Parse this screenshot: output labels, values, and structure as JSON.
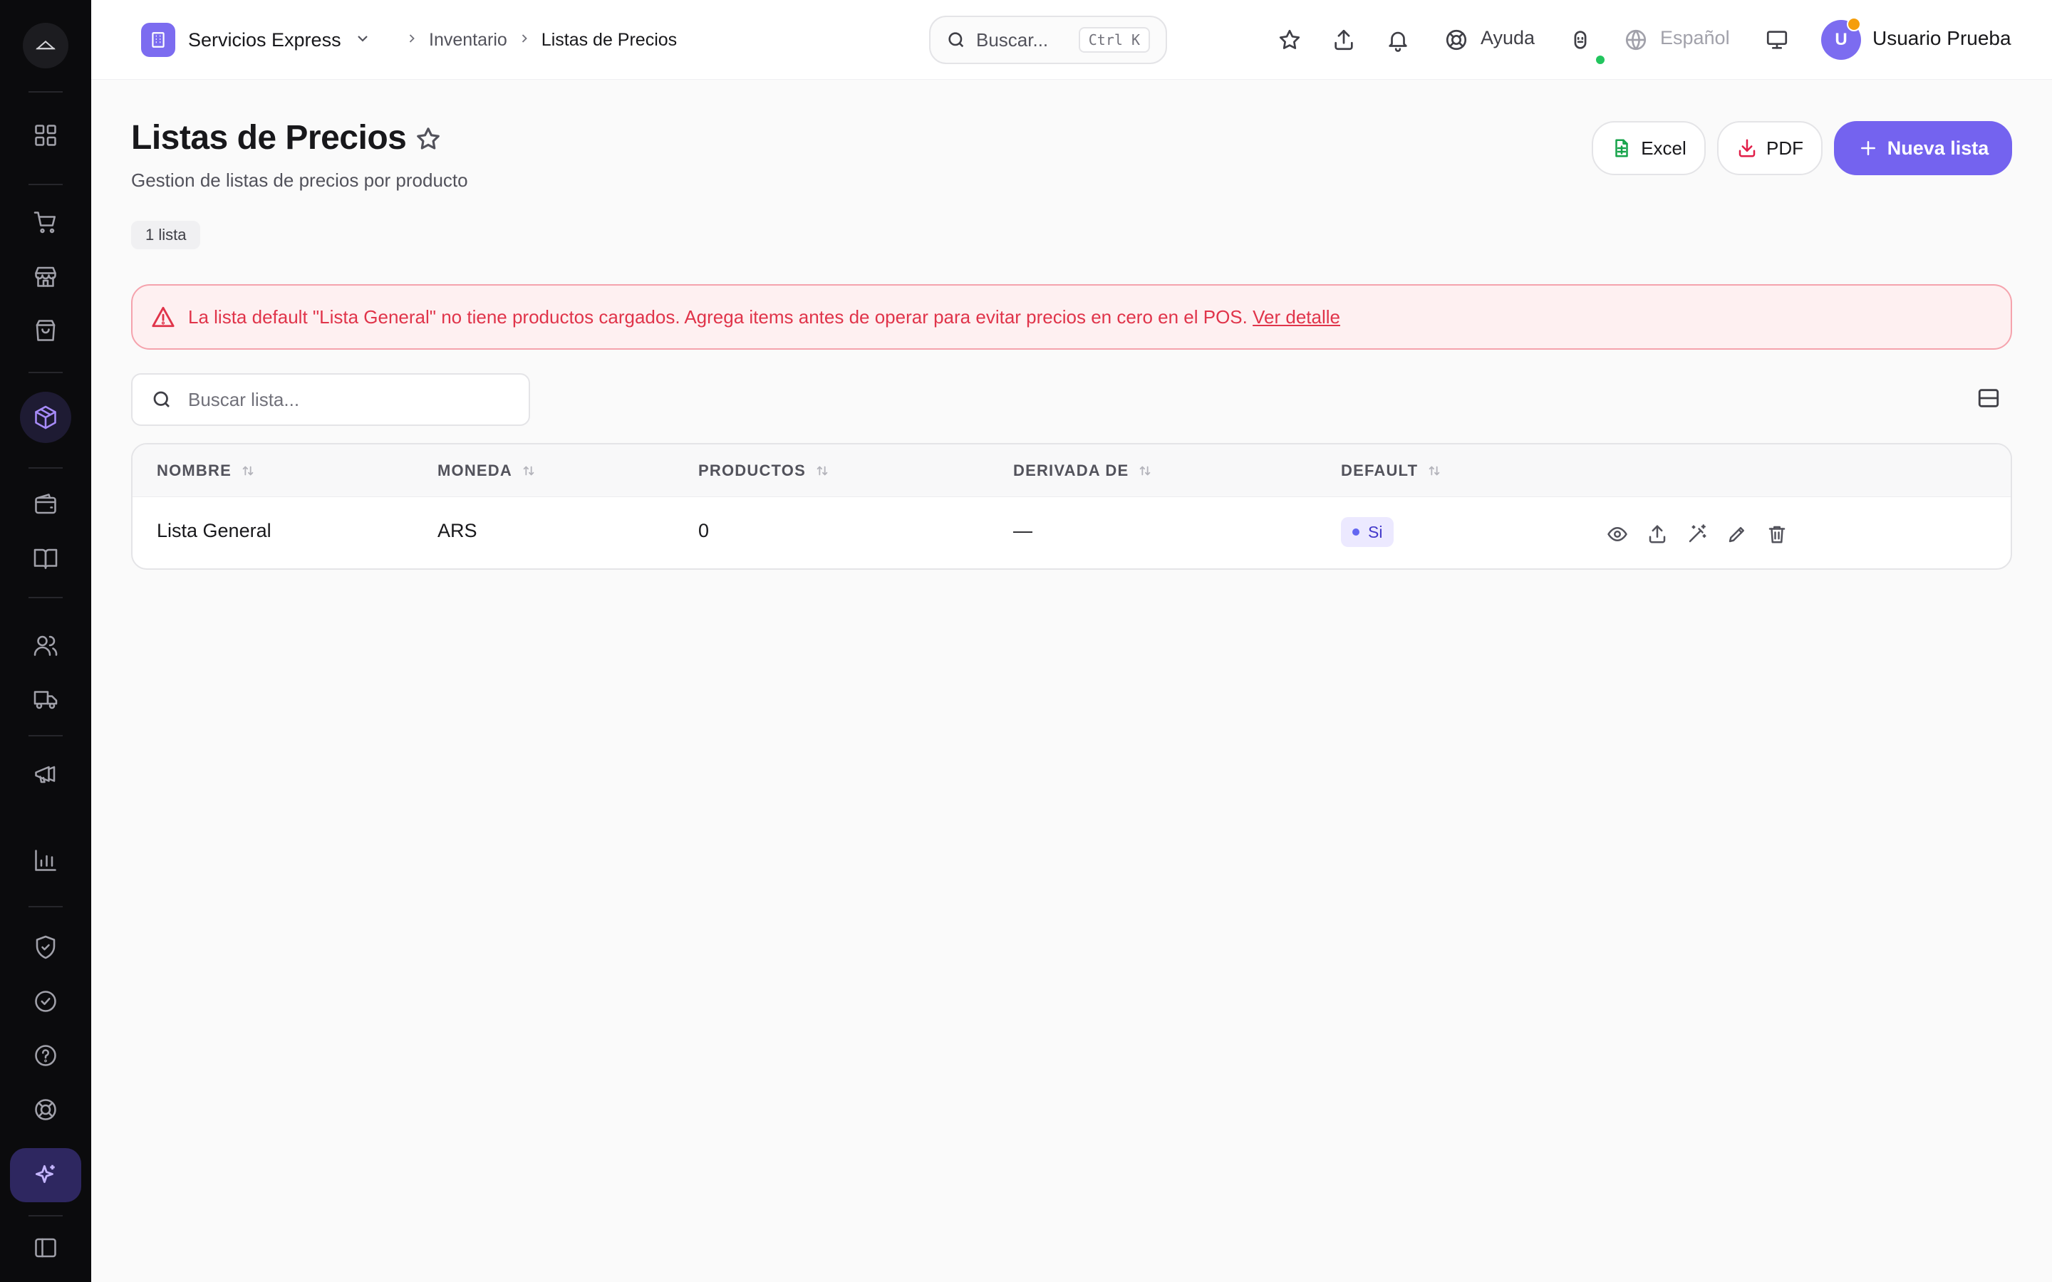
{
  "sidebar": {
    "items": [
      {
        "name": "dashboard",
        "icon": "grid-icon"
      },
      {
        "name": "sales",
        "icon": "cart-icon"
      },
      {
        "name": "store",
        "icon": "store-icon"
      },
      {
        "name": "purchases",
        "icon": "bag-icon"
      },
      {
        "name": "inventory",
        "icon": "box-icon",
        "active": true
      },
      {
        "name": "wallet",
        "icon": "wallet-icon"
      },
      {
        "name": "books",
        "icon": "book-icon"
      },
      {
        "name": "users",
        "icon": "users-icon"
      },
      {
        "name": "delivery",
        "icon": "truck-icon"
      },
      {
        "name": "marketing",
        "icon": "megaphone-icon"
      },
      {
        "name": "reports",
        "icon": "chart-icon"
      },
      {
        "name": "security",
        "icon": "shield-icon"
      },
      {
        "name": "tasks",
        "icon": "check-circle-icon"
      },
      {
        "name": "help",
        "icon": "question-icon"
      },
      {
        "name": "support",
        "icon": "lifebuoy-icon"
      },
      {
        "name": "ai-assistant",
        "icon": "sparkles-icon"
      },
      {
        "name": "collapse",
        "icon": "sidebar-toggle-icon"
      }
    ]
  },
  "header": {
    "org_name": "Servicios Express",
    "breadcrumb": [
      "Inventario",
      "Listas de Precios"
    ],
    "search_placeholder": "Buscar...",
    "search_shortcut": "Ctrl K",
    "help_label": "Ayuda",
    "language_label": "Español",
    "user_initial": "U",
    "user_name": "Usuario Prueba"
  },
  "page": {
    "title": "Listas de Precios",
    "subtitle": "Gestion de listas de precios por producto",
    "count_label": "1 lista",
    "excel_label": "Excel",
    "pdf_label": "PDF",
    "new_label": "Nueva lista"
  },
  "alert": {
    "message": "La lista default \"Lista General\" no tiene productos cargados. Agrega items antes de operar para evitar precios en cero en el POS.",
    "link_label": "Ver detalle"
  },
  "filter": {
    "search_placeholder": "Buscar lista..."
  },
  "table": {
    "headers": [
      "NOMBRE",
      "MONEDA",
      "PRODUCTOS",
      "DERIVADA DE",
      "DEFAULT"
    ],
    "rows": [
      {
        "nombre": "Lista General",
        "moneda": "ARS",
        "productos": "0",
        "derivada": "—",
        "default": "Si"
      }
    ],
    "row_actions": [
      "eye-icon",
      "upload-icon",
      "magic-wand-icon",
      "pencil-icon",
      "trash-icon"
    ]
  },
  "colors": {
    "accent": "#7463ef",
    "sidebar_bg": "#0b0b0d",
    "alert_text": "#e0344a",
    "alert_bg": "#fef0f1"
  }
}
